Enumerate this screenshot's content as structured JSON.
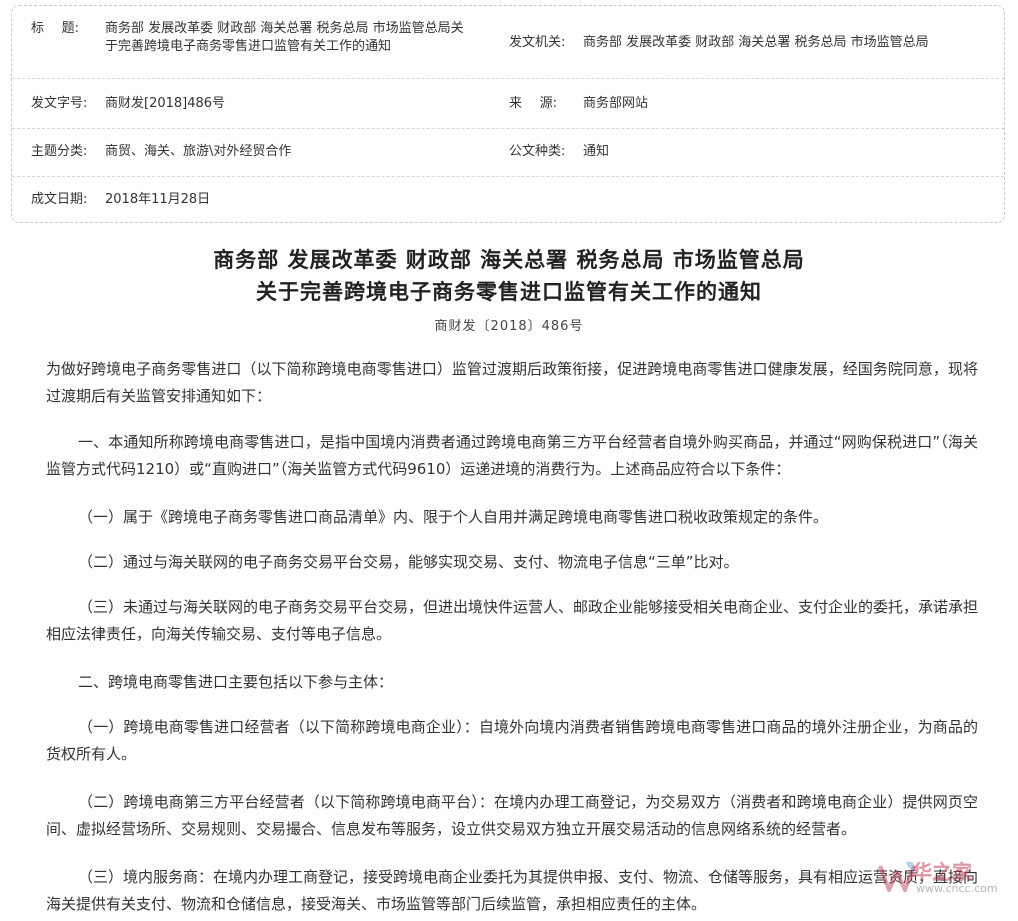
{
  "meta": {
    "title_label_1": "标",
    "title_label_2": "题:",
    "title_value_line1": "商务部 发展改革委 财政部 海关总署 税务总局 市场监管总局关",
    "title_value_line2": "于完善跨境电子商务零售进口监管有关工作的通知",
    "issuer_label": "发文机关:",
    "issuer_value": "商务部 发展改革委 财政部 海关总署 税务总局 市场监管总局",
    "docno_label": "发文字号:",
    "docno_value": "商财发[2018]486号",
    "source_label_1": "来",
    "source_label_2": "源:",
    "source_value": "商务部网站",
    "topic_label": "主题分类:",
    "topic_value": "商贸、海关、旅游\\对外经贸合作",
    "type_label": "公文种类:",
    "type_value": "通知",
    "date_label": "成文日期:",
    "date_value": "2018年11月28日"
  },
  "heading": {
    "line1": "商务部 发展改革委 财政部 海关总署 税务总局 市场监管总局",
    "line2": "关于完善跨境电子商务零售进口监管有关工作的通知",
    "docno": "商财发〔2018〕486号"
  },
  "body": {
    "p0": "为做好跨境电子商务零售进口（以下简称跨境电商零售进口）监管过渡期后政策衔接，促进跨境电商零售进口健康发展，经国务院同意，现将过渡期后有关监管安排通知如下：",
    "p1": "一、本通知所称跨境电商零售进口，是指中国境内消费者通过跨境电商第三方平台经营者自境外购买商品，并通过“网购保税进口”（海关监管方式代码1210）或“直购进口”（海关监管方式代码9610）运递进境的消费行为。上述商品应符合以下条件：",
    "p2": "（一）属于《跨境电子商务零售进口商品清单》内、限于个人自用并满足跨境电商零售进口税收政策规定的条件。",
    "p3": "（二）通过与海关联网的电子商务交易平台交易，能够实现交易、支付、物流电子信息“三单”比对。",
    "p4": "（三）未通过与海关联网的电子商务交易平台交易，但进出境快件运营人、邮政企业能够接受相关电商企业、支付企业的委托，承诺承担相应法律责任，向海关传输交易、支付等电子信息。",
    "p5": "二、跨境电商零售进口主要包括以下参与主体：",
    "p6": "（一）跨境电商零售进口经营者（以下简称跨境电商企业）：自境外向境内消费者销售跨境电商零售进口商品的境外注册企业，为商品的货权所有人。",
    "p7": "（二）跨境电商第三方平台经营者（以下简称跨境电商平台）：在境内办理工商登记，为交易双方（消费者和跨境电商企业）提供网页空间、虚拟经营场所、交易规则、交易撮合、信息发布等服务，设立供交易双方独立开展交易活动的信息网络系统的经营者。",
    "p8": "（三）境内服务商：在境内办理工商登记，接受跨境电商企业委托为其提供申报、支付、物流、仓储等服务，具有相应运营资质，直接向海关提供有关支付、物流和仓储信息，接受海关、市场监管等部门后续监管，承担相应责任的主体。"
  },
  "watermark": {
    "name": "华之家",
    "url": "www.cncc.com",
    "colors": {
      "accent": "#c83c5a",
      "leaf": "#7ab8e0"
    }
  }
}
